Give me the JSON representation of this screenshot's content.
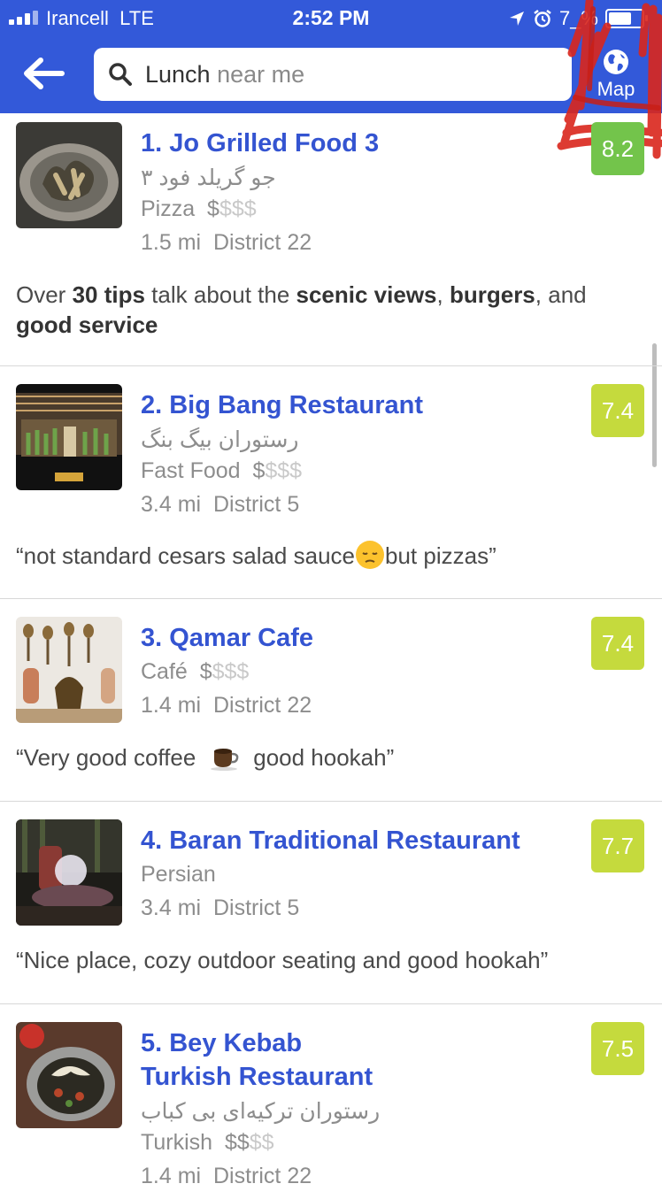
{
  "status_bar": {
    "carrier": "Irancell",
    "network": "LTE",
    "time": "2:52 PM",
    "battery": "7_%",
    "battery_level": 0.78
  },
  "header": {
    "search_query": "Lunch",
    "search_placeholder": "near me",
    "map_label": "Map"
  },
  "colors": {
    "header": "#3359d9",
    "name": "#3454d1",
    "score_high": "#73c44b",
    "score_mid": "#c5da3d",
    "scribble": "#d9261c"
  },
  "venues": [
    {
      "name": "1. Jo Grilled Food 3",
      "native_name": "جو گریلد فود ۳",
      "category": "Pizza",
      "price_on": "$",
      "price_off": "$$$",
      "distance": "1.5 mi",
      "district": "District 22",
      "score": "8.2",
      "tip": {
        "pre": "Over ",
        "b1": "30 tips",
        "mid1": " talk about the ",
        "b2": "scenic views",
        "mid2": ", ",
        "b3": "burgers",
        "mid3": ", and ",
        "b4": "good service"
      }
    },
    {
      "name": "2. Big Bang Restaurant",
      "native_name": "رستوران بیگ بنگ",
      "category": "Fast Food",
      "price_on": "$",
      "price_off": "$$$",
      "distance": "3.4 mi",
      "district": "District 5",
      "score": "7.4",
      "tip_pre": "“not standard cesars salad sauce",
      "tip_emoji": "pensive-face-icon",
      "tip_post": "but pizzas”"
    },
    {
      "name": "3. Qamar Cafe",
      "category": "Café",
      "price_on": "$",
      "price_off": "$$$",
      "distance": "1.4 mi",
      "district": "District 22",
      "score": "7.4",
      "tip_pre": "“Very good coffee",
      "tip_emoji": "coffee-icon",
      "tip_post": "good hookah”"
    },
    {
      "name": "4. Baran Traditional Restaurant",
      "category": "Persian",
      "distance": "3.4 mi",
      "district": "District 5",
      "score": "7.7",
      "tip_text": "“Nice place, cozy outdoor seating and good hookah”"
    },
    {
      "name_line1": "5. Bey Kebab",
      "name_line2": "Turkish Restaurant",
      "native_name": "رستوران ترکیه‌ای بی کباب",
      "category": "Turkish",
      "price_on": "$$",
      "price_off": "$$",
      "distance": "1.4 mi",
      "district": "District 22",
      "score": "7.5"
    }
  ]
}
